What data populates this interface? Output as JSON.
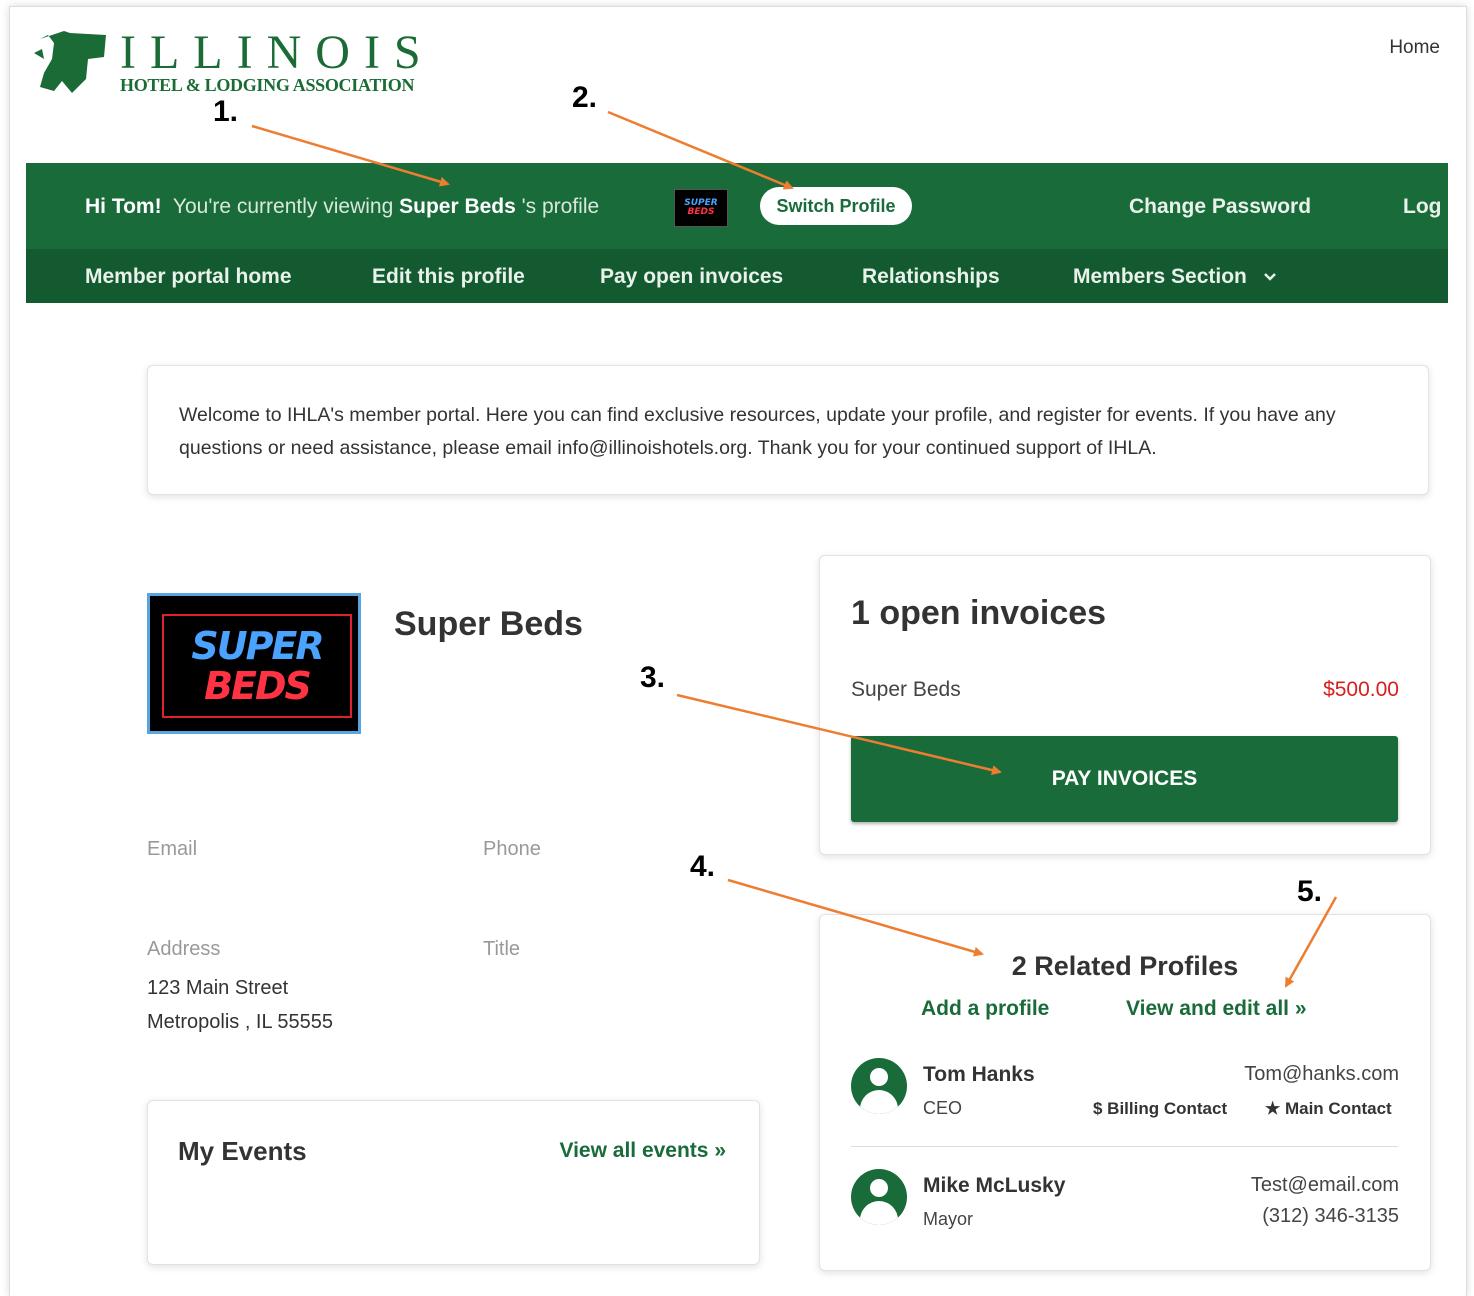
{
  "header": {
    "logo_word": "ILLINOIS",
    "logo_sub": "HOTEL & LODGING ASSOCIATION",
    "home_link": "Home"
  },
  "annotations": [
    "1.",
    "2.",
    "3.",
    "4.",
    "5."
  ],
  "topbar": {
    "greeting_hi": "Hi Tom!",
    "greeting_viewing": "You're currently viewing",
    "greeting_org": "Super Beds",
    "greeting_suffix": "'s profile",
    "mini_logo_top": "SUPER",
    "mini_logo_bottom": "BEDS",
    "switch_profile": "Switch Profile",
    "change_password": "Change Password",
    "logout": "Log"
  },
  "nav": {
    "items": [
      "Member portal home",
      "Edit this profile",
      "Pay open invoices",
      "Relationships",
      "Members Section"
    ],
    "dropdown_icon": "chevron-down-icon"
  },
  "welcome": {
    "text": "Welcome to IHLA's member portal. Here you can find exclusive resources, update your profile, and register for events. If you have any questions or need assistance, please email info@illinoishotels.org. Thank you for your continued support of IHLA."
  },
  "profile": {
    "logo_top": "SUPER",
    "logo_bottom": "BEDS",
    "name": "Super Beds",
    "email_label": "Email",
    "phone_label": "Phone",
    "address_label": "Address",
    "title_label": "Title",
    "address_line1": "123 Main Street",
    "address_line2": "Metropolis , IL 55555"
  },
  "events": {
    "title": "My Events",
    "view_all": "View all events  »"
  },
  "invoices": {
    "title": "1 open invoices",
    "items": [
      {
        "name": "Super Beds",
        "amount": "$500.00"
      }
    ],
    "pay_button": "PAY INVOICES"
  },
  "related": {
    "title": "2 Related Profiles",
    "add_link": "Add a profile",
    "view_link": "View and edit all  »",
    "people": [
      {
        "name": "Tom Hanks",
        "title": "CEO",
        "email": "Tom@hanks.com",
        "badge1": "$ Billing Contact",
        "badge2": "★ Main Contact"
      },
      {
        "name": "Mike McLusky",
        "title": "Mayor",
        "email": "Test@email.com",
        "phone": "(312) 346-3135"
      }
    ]
  },
  "colors": {
    "brand_green": "#1a6b3a",
    "nav_green": "#145a30",
    "arrow_orange": "#ed7d31",
    "amount_red": "#d62020"
  }
}
